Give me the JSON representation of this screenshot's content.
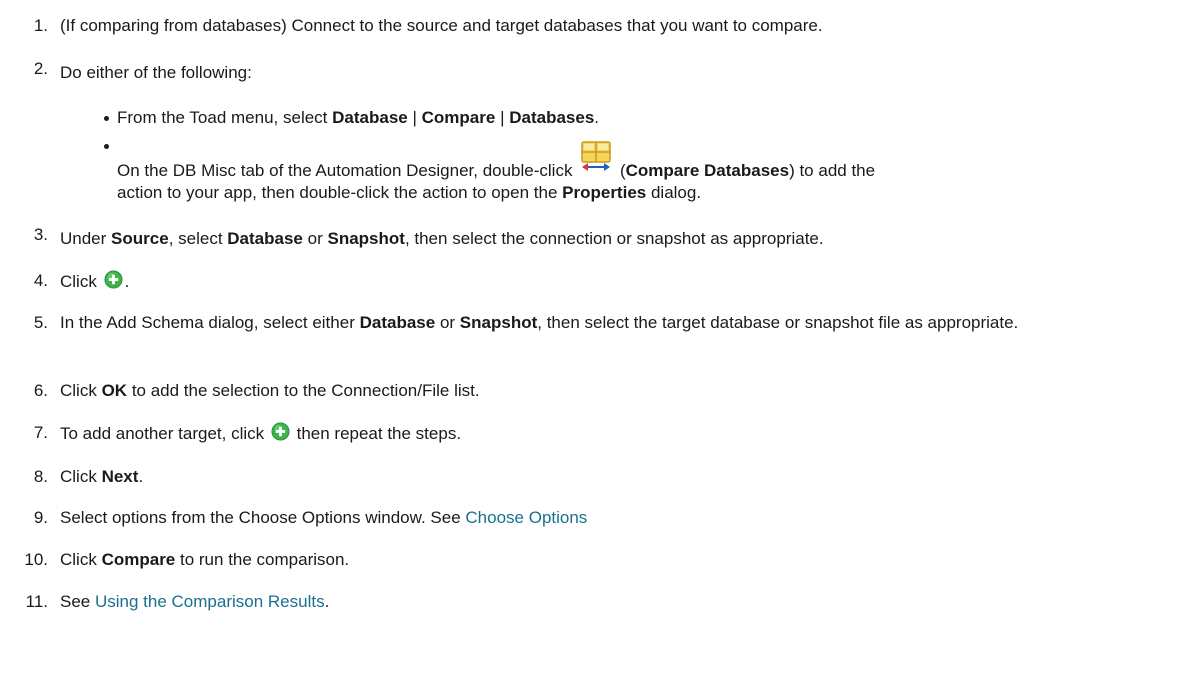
{
  "steps": {
    "s1": {
      "num": "1.",
      "t": "(If comparing from databases) Connect to the source and target databases that you want to compare."
    },
    "s2": {
      "num": "2.",
      "t": "Do either of the following:"
    },
    "s3": {
      "num": "3.",
      "a": "Under",
      "b": "Source",
      "c": ", select",
      "d": "Database",
      "e": "or",
      "f": "Snapshot",
      "g": ", then select the connection or snapshot as appropriate."
    },
    "s4": {
      "num": "4.",
      "a": "Click",
      "b": "."
    },
    "s5": {
      "num": "5.",
      "a": "In the Add Schema dialog, select either",
      "b": "Database",
      "c": "or",
      "d": "Snapshot",
      "e": ", then select the target database or snapshot file as appropriate."
    },
    "s6": {
      "num": "6.",
      "a": "Click",
      "b": "OK",
      "c": "to add the selection to the Connection/File list."
    },
    "s7": {
      "num": "7.",
      "a": "To add another target, click",
      "b": "then repeat the steps."
    },
    "s8": {
      "num": "8.",
      "a": "Click",
      "b": "Next",
      "c": "."
    },
    "s9": {
      "num": "9.",
      "a": "Select options from the Choose Options window. See",
      "link": "Choose Options"
    },
    "s10": {
      "num": "10.",
      "a": "Click",
      "b": "Compare",
      "c": "to run the comparison."
    },
    "s11": {
      "num": "11.",
      "a": "See",
      "link": "Using the Comparison Results",
      "b": "."
    }
  },
  "bullets": {
    "b1": {
      "a": "From the Toad menu, select",
      "b": "Database",
      "c": "|",
      "d": "Compare",
      "e": "|",
      "f": "Databases",
      "g": "."
    },
    "b2": {
      "a": "On the DB Misc tab of the Automation Designer, double-click",
      "b": "(",
      "c": "Compare Databases",
      "d": ") to add the",
      "e": "action to your app, then double-click the action to open the",
      "f": "Properties",
      "g": "dialog."
    }
  },
  "icons": {
    "add": "add-circle-icon",
    "compare_databases": "compare-databases-icon"
  },
  "colors": {
    "text": "#1a1a1a",
    "link": "#1a7090",
    "add_icon": "#3cb44a"
  }
}
